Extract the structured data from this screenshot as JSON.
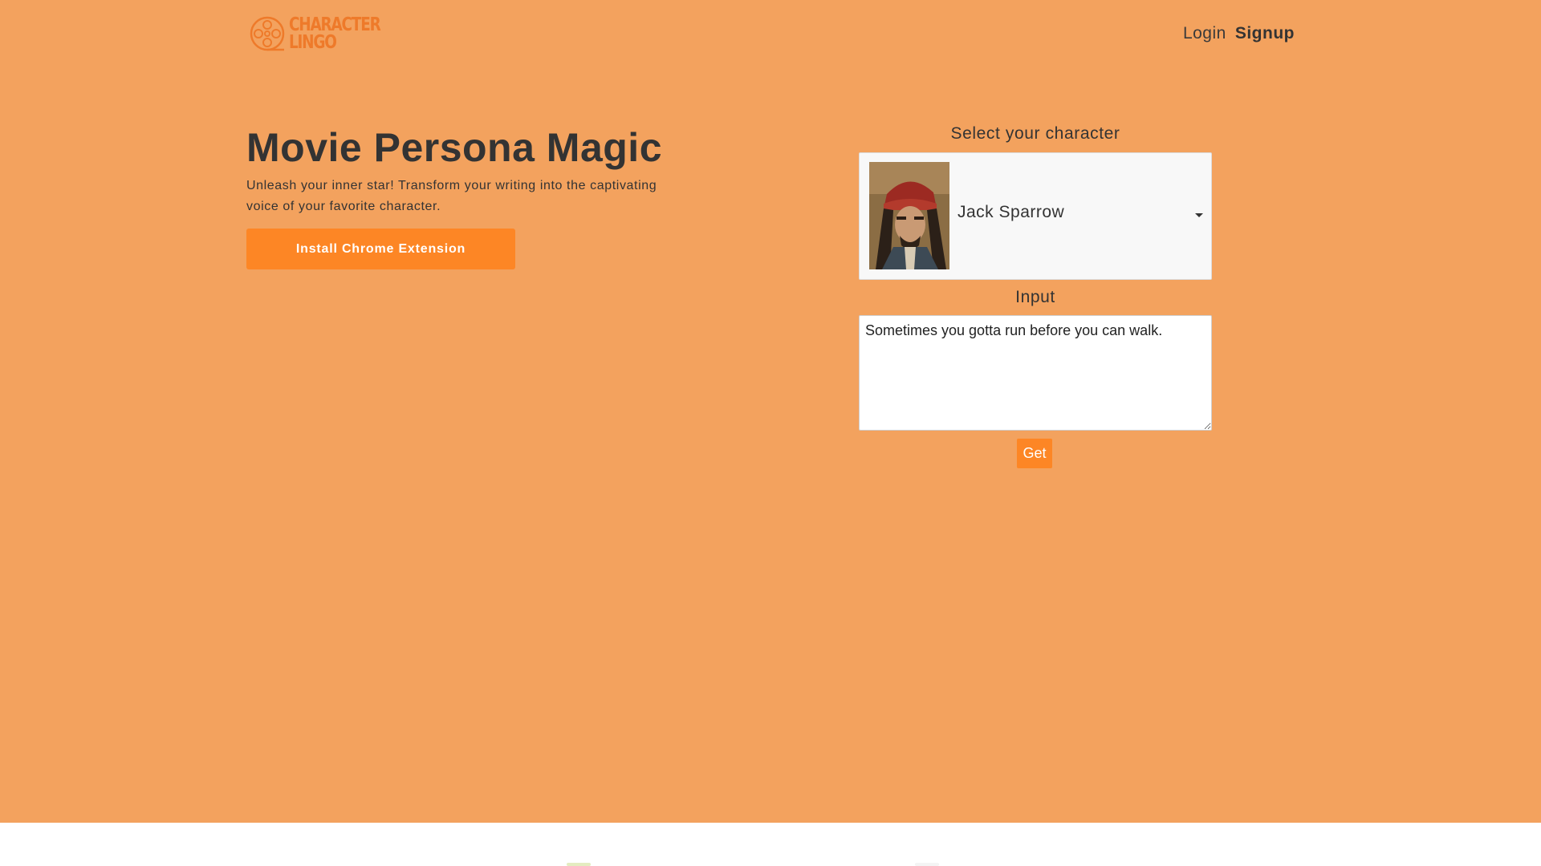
{
  "header": {
    "logo": {
      "line1": "CHARACTER",
      "line2": "LINGO"
    },
    "nav": {
      "login": "Login",
      "signup": "Signup"
    }
  },
  "hero": {
    "title": "Movie Persona Magic",
    "subtitle": "Unleash your inner star! Transform your writing into the captivating voice of your favorite character.",
    "install_button": "Install Chrome Extension"
  },
  "translator": {
    "select_label": "Select your character",
    "selected_character": "Jack Sparrow",
    "input_label": "Input",
    "input_value": "Sometimes you gotta run before you can walk.",
    "get_button": "Get"
  },
  "colors": {
    "background": "#f3a25e",
    "accent": "#fd8625",
    "logo": "#ee7a2a",
    "text": "#333333"
  },
  "icons": {
    "logo": "film-reel-icon",
    "select_caret": "caret-down-icon"
  }
}
